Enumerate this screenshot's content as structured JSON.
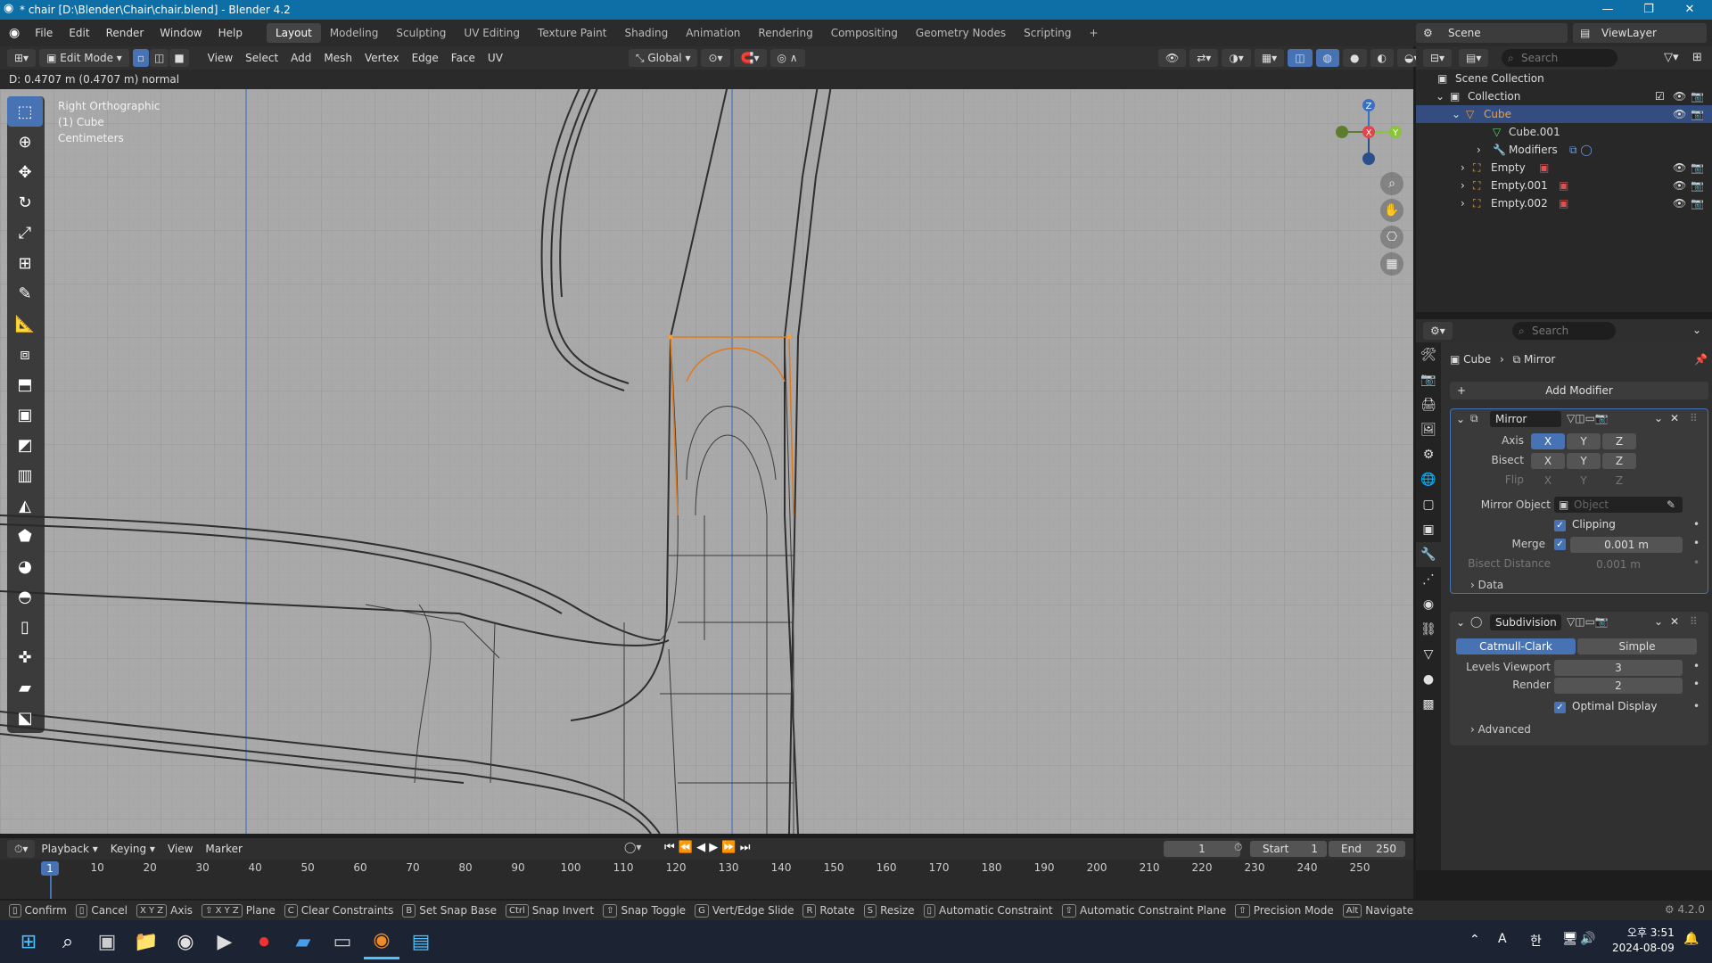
{
  "window": {
    "title": "* chair [D:\\Blender\\Chair\\chair.blend] - Blender 4.2",
    "minimize": "—",
    "maximize": "❐",
    "close": "✕"
  },
  "menubar": {
    "items": [
      "File",
      "Edit",
      "Render",
      "Window",
      "Help"
    ],
    "workspaces": [
      "Layout",
      "Modeling",
      "Sculpting",
      "UV Editing",
      "Texture Paint",
      "Shading",
      "Animation",
      "Rendering",
      "Compositing",
      "Geometry Nodes",
      "Scripting"
    ],
    "active_workspace": "Layout",
    "add_workspace": "+",
    "scene_label": "Scene",
    "viewlayer_label": "ViewLayer"
  },
  "viewport_header": {
    "mode": "Edit Mode",
    "menus": [
      "View",
      "Select",
      "Add",
      "Mesh",
      "Vertex",
      "Edge",
      "Face",
      "UV"
    ],
    "transform_orientation": "Global"
  },
  "viewport": {
    "status_text": "D: 0.4707 m (0.4707 m) normal",
    "view_name": "Right Orthographic",
    "object_name": "(1) Cube",
    "units": "Centimeters"
  },
  "gizmo": {
    "z": "Z",
    "x": "X",
    "y": "Y"
  },
  "outliner": {
    "search_placeholder": "Search",
    "rows": [
      {
        "label": "Scene Collection"
      },
      {
        "label": "Collection"
      },
      {
        "label": "Cube"
      },
      {
        "label": "Cube.001"
      },
      {
        "label": "Modifiers"
      },
      {
        "label": "Empty"
      },
      {
        "label": "Empty.001"
      },
      {
        "label": "Empty.002"
      }
    ]
  },
  "properties": {
    "search_placeholder": "Search",
    "breadcrumb_object": "Cube",
    "breadcrumb_modifier": "Mirror",
    "add_modifier": "Add Modifier",
    "mirror": {
      "name": "Mirror",
      "axis_label": "Axis",
      "bisect_label": "Bisect",
      "flip_label": "Flip",
      "x": "X",
      "y": "Y",
      "z": "Z",
      "mirror_object_label": "Mirror Object",
      "mirror_object_placeholder": "Object",
      "clipping_label": "Clipping",
      "merge_label": "Merge",
      "merge_value": "0.001 m",
      "bisect_distance_label": "Bisect Distance",
      "bisect_distance_value": "0.001 m",
      "data_label": "Data"
    },
    "subdivision": {
      "name": "Subdivision",
      "catmull": "Catmull-Clark",
      "simple": "Simple",
      "levels_viewport_label": "Levels Viewport",
      "levels_viewport_value": "3",
      "render_label": "Render",
      "render_value": "2",
      "optimal_display_label": "Optimal Display",
      "advanced_label": "Advanced"
    }
  },
  "timeline": {
    "menus": [
      "Playback",
      "Keying",
      "View",
      "Marker"
    ],
    "current_frame": "1",
    "start_label": "Start",
    "start_value": "1",
    "end_label": "End",
    "end_value": "250",
    "ticks": [
      "1",
      "10",
      "20",
      "30",
      "40",
      "50",
      "60",
      "70",
      "80",
      "90",
      "100",
      "110",
      "120",
      "130",
      "140",
      "150",
      "160",
      "170",
      "180",
      "190",
      "200",
      "210",
      "220",
      "230",
      "240",
      "250"
    ]
  },
  "statusbar": {
    "items": [
      {
        "key": "",
        "label": "Confirm"
      },
      {
        "key": "",
        "label": "Cancel"
      },
      {
        "key": "X Y Z",
        "label": "Axis"
      },
      {
        "key": "⇧ X Y Z",
        "label": "Plane"
      },
      {
        "key": "C",
        "label": "Clear Constraints"
      },
      {
        "key": "B",
        "label": "Set Snap Base"
      },
      {
        "key": "Ctrl",
        "label": "Snap Invert"
      },
      {
        "key": "⇧",
        "label": "Snap Toggle"
      },
      {
        "key": "G",
        "label": "Vert/Edge Slide"
      },
      {
        "key": "R",
        "label": "Rotate"
      },
      {
        "key": "S",
        "label": "Resize"
      },
      {
        "key": "",
        "label": "Automatic Constraint"
      },
      {
        "key": "⇧",
        "label": "Automatic Constraint Plane"
      },
      {
        "key": "⇧",
        "label": "Precision Mode"
      },
      {
        "key": "Alt",
        "label": "Navigate"
      }
    ],
    "version": "4.2.0"
  },
  "taskbar": {
    "ime_letter": "A",
    "ime_hangul": "한",
    "time": "오후 3:51",
    "date": "2024-08-09"
  }
}
